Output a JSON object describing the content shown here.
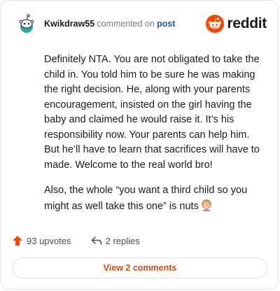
{
  "comment": {
    "author": "Kwikdraw55",
    "action_text": "commented on",
    "post_link": "post",
    "paragraphs": [
      "Definitely NTA. You are not obligated to take the child in. You told him to be sure he was making the right decision. He, along with your parents encouragement, insisted on the girl having the baby and claimed he would raise it. It’s his responsibility now. Your parents can help him. But he’ll have to learn that sacrifices will have to made. Welcome to the real world bro!",
      "Also, the whole “you want a third child so you might as well take this one” is nuts"
    ],
    "emoji": "woman-facepalming-emoji"
  },
  "brand": {
    "wordmark": "reddit",
    "accent": "#ff4500"
  },
  "actions": {
    "upvotes": "93 upvotes",
    "replies": "2 replies",
    "upvote_color": "#ff4500"
  },
  "footer": {
    "view_comments": "View 2 comments",
    "link_color": "#d34b14"
  }
}
